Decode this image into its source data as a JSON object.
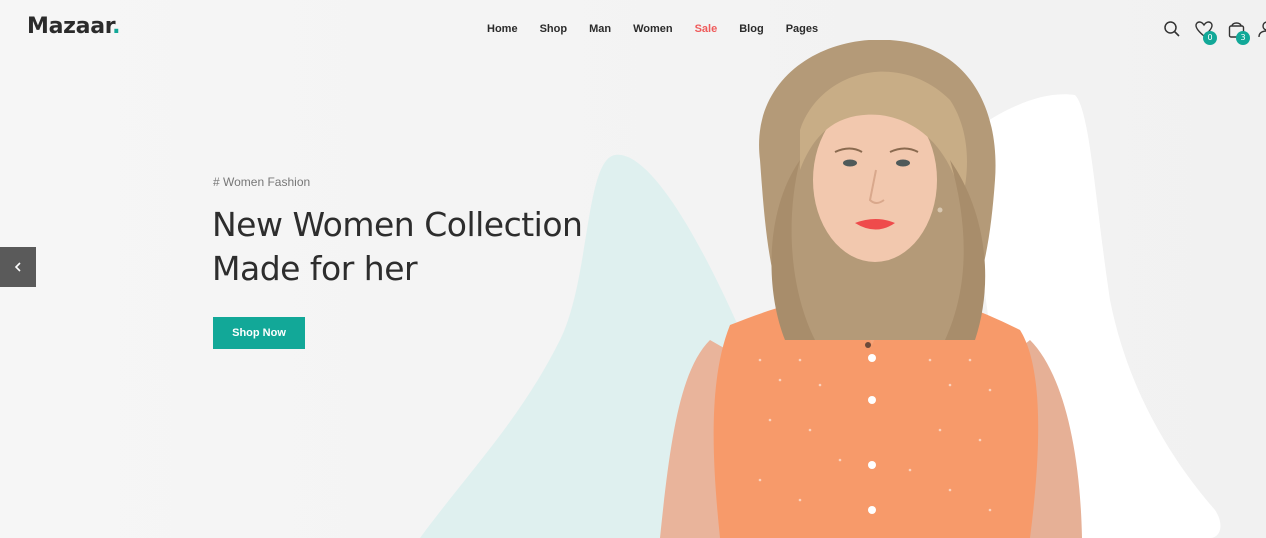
{
  "brand": {
    "name": "Mazaar",
    "dot": "."
  },
  "nav": {
    "items": [
      {
        "label": "Home"
      },
      {
        "label": "Shop"
      },
      {
        "label": "Man"
      },
      {
        "label": "Women"
      },
      {
        "label": "Sale"
      },
      {
        "label": "Blog"
      },
      {
        "label": "Pages"
      }
    ]
  },
  "header_icons": {
    "wishlist_count": "0",
    "cart_count": "3"
  },
  "hero": {
    "tag": "# Women Fashion",
    "headline_line1": "New Women Collection",
    "headline_line2": "Made for her",
    "cta_label": "Shop Now"
  },
  "colors": {
    "accent": "#12a898",
    "sale": "#ef5b5b",
    "background": "#f5f5f5",
    "shape_teal": "#dff0ef",
    "shirt": "#f79a6a"
  }
}
